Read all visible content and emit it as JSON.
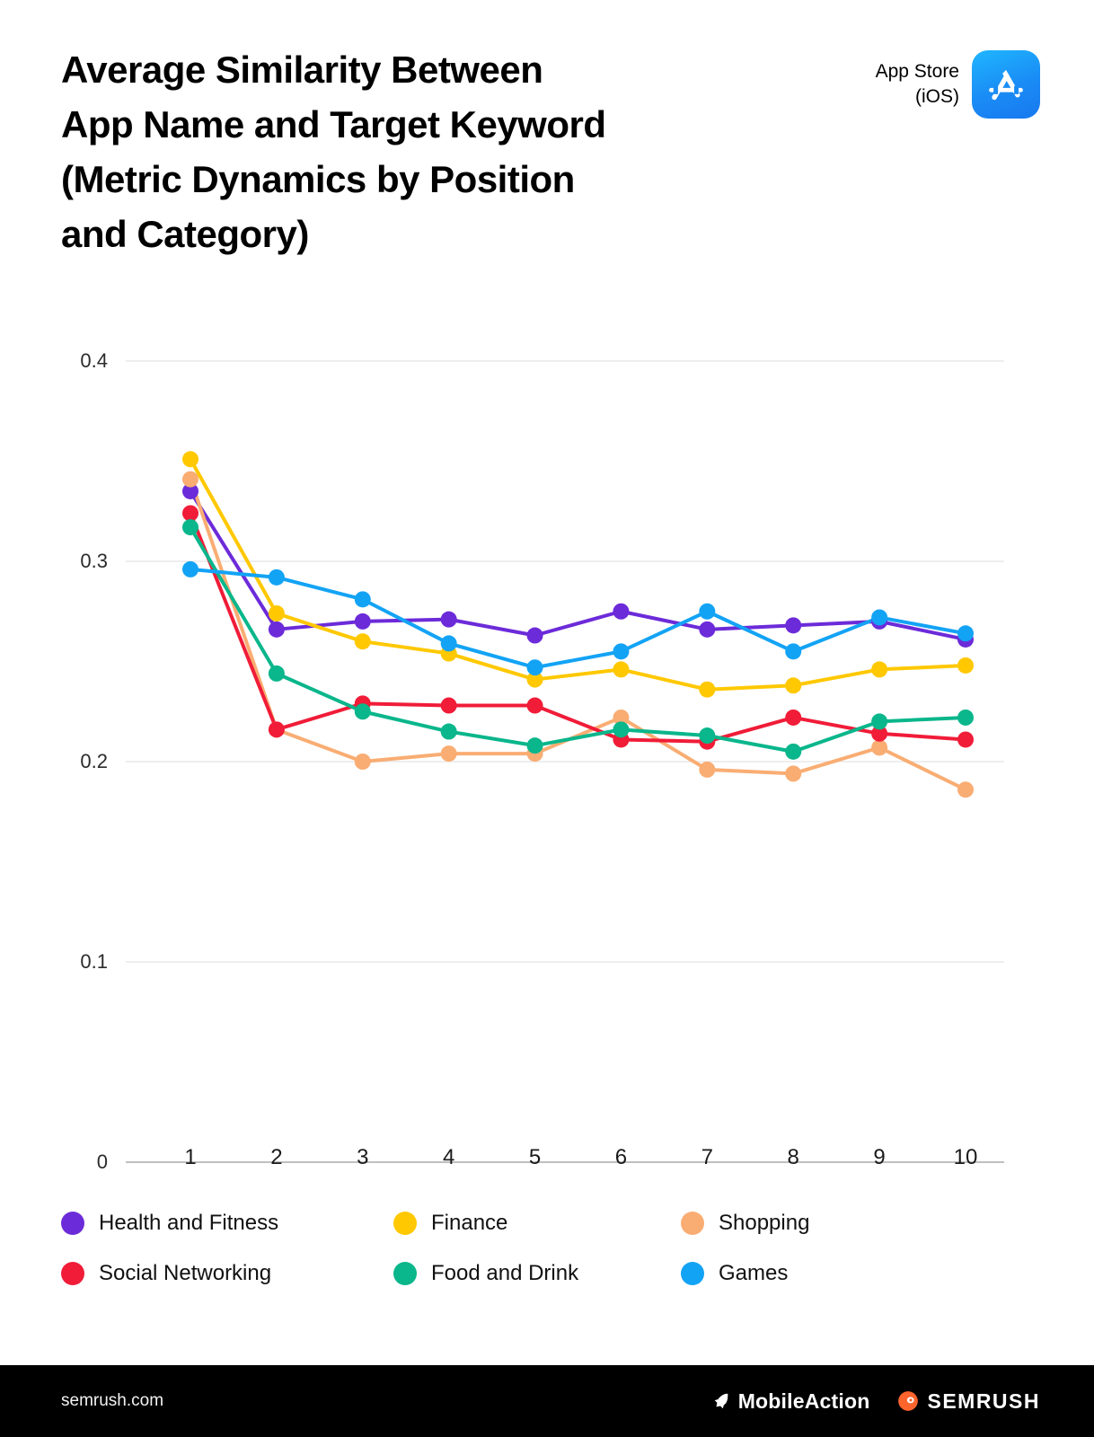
{
  "header": {
    "title": "Average Similarity Between\nApp Name and Target Keyword\n(Metric Dynamics by Position\nand Category)",
    "badge_text": "App Store\n(iOS)",
    "badge_icon": "app-store-icon"
  },
  "footer": {
    "site": "semrush.com",
    "brand_mobileaction": "MobileAction",
    "brand_semrush": "SEMRUSH"
  },
  "colors": {
    "health_and_fitness": "#6c2bd9",
    "finance": "#ffc800",
    "shopping": "#f9ad73",
    "social_networking": "#f01c38",
    "food_and_drink": "#0ab68b",
    "games": "#13a3f5",
    "grid": "#e9e9ea",
    "footer_bg": "#000000",
    "accent_orange": "#ff642d"
  },
  "chart_data": {
    "type": "line",
    "title": "Average Similarity Between App Name and Target Keyword (Metric Dynamics by Position and Category)",
    "xlabel": "",
    "ylabel": "",
    "x": [
      1,
      2,
      3,
      4,
      5,
      6,
      7,
      8,
      9,
      10
    ],
    "categories": [
      "1",
      "2",
      "3",
      "4",
      "5",
      "6",
      "7",
      "8",
      "9",
      "10"
    ],
    "ylim": [
      0,
      0.4
    ],
    "yticks": [
      0.4,
      0.3,
      0.2,
      0.1,
      0
    ],
    "ytick_labels": [
      "0.4",
      "0.3",
      "0.2",
      "0.1",
      "0"
    ],
    "grid": true,
    "legend_position": "bottom",
    "markers": true,
    "series": [
      {
        "name": "Health and Fitness",
        "color": "#6c2bd9",
        "values": [
          0.335,
          0.266,
          0.27,
          0.271,
          0.263,
          0.275,
          0.266,
          0.268,
          0.27,
          0.261
        ]
      },
      {
        "name": "Finance",
        "color": "#ffc800",
        "values": [
          0.351,
          0.274,
          0.26,
          0.254,
          0.241,
          0.246,
          0.236,
          0.238,
          0.246,
          0.248
        ]
      },
      {
        "name": "Shopping",
        "color": "#f9ad73",
        "values": [
          0.341,
          0.216,
          0.2,
          0.204,
          0.204,
          0.222,
          0.196,
          0.194,
          0.207,
          0.186
        ]
      },
      {
        "name": "Social Networking",
        "color": "#f01c38",
        "values": [
          0.324,
          0.216,
          0.229,
          0.228,
          0.228,
          0.211,
          0.21,
          0.222,
          0.214,
          0.211
        ]
      },
      {
        "name": "Food and Drink",
        "color": "#0ab68b",
        "values": [
          0.317,
          0.244,
          0.225,
          0.215,
          0.208,
          0.216,
          0.213,
          0.205,
          0.22,
          0.222
        ]
      },
      {
        "name": "Games",
        "color": "#13a3f5",
        "values": [
          0.296,
          0.292,
          0.281,
          0.259,
          0.247,
          0.255,
          0.275,
          0.255,
          0.272,
          0.264
        ]
      }
    ]
  },
  "legend": [
    {
      "label": "Health and Fitness",
      "color": "#6c2bd9"
    },
    {
      "label": "Finance",
      "color": "#ffc800"
    },
    {
      "label": "Shopping",
      "color": "#f9ad73"
    },
    {
      "label": "Social Networking",
      "color": "#f01c38"
    },
    {
      "label": "Food and Drink",
      "color": "#0ab68b"
    },
    {
      "label": "Games",
      "color": "#13a3f5"
    }
  ]
}
